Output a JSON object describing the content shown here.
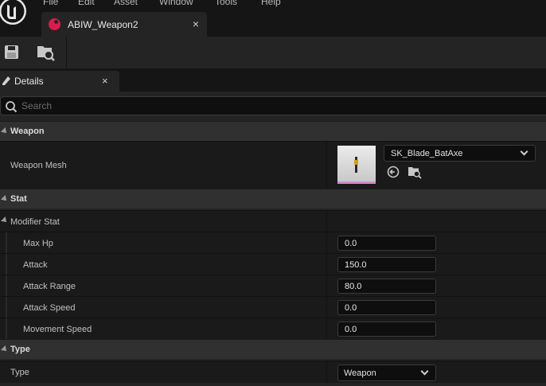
{
  "menu": [
    "File",
    "Edit",
    "Asset",
    "Window",
    "Tools",
    "Help"
  ],
  "tab": {
    "title": "ABIW_Weapon2",
    "close": "×"
  },
  "details_tab": {
    "title": "Details",
    "close": "×"
  },
  "search": {
    "placeholder": "Search",
    "value": ""
  },
  "categories": {
    "weapon": "Weapon",
    "stat": "Stat",
    "type": "Type"
  },
  "weapon_mesh": {
    "label": "Weapon Mesh",
    "asset": "SK_Blade_BatAxe"
  },
  "modifier_stat": {
    "label": "Modifier Stat",
    "fields": [
      {
        "label": "Max Hp",
        "value": "0.0"
      },
      {
        "label": "Attack",
        "value": "150.0"
      },
      {
        "label": "Attack Range",
        "value": "80.0"
      },
      {
        "label": "Attack Speed",
        "value": "0.0"
      },
      {
        "label": "Movement Speed",
        "value": "0.0"
      }
    ]
  },
  "type_prop": {
    "label": "Type",
    "value": "Weapon"
  },
  "colors": {
    "accent": "#d81e4f",
    "panel": "#242424",
    "row": "#1a1a1a"
  },
  "icons": [
    "unreal-logo-icon",
    "blueprint-icon",
    "save-icon",
    "browse-icon",
    "details-icon",
    "search-icon",
    "use-selected-icon"
  ]
}
